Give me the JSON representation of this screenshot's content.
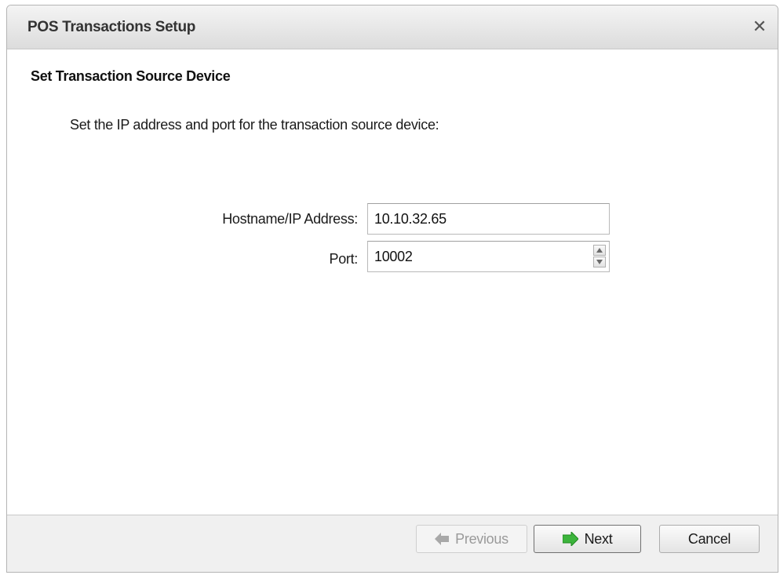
{
  "window": {
    "title": "POS Transactions Setup",
    "close_icon": "close-icon"
  },
  "content": {
    "heading": "Set Transaction Source Device",
    "instruction": "Set the IP address and port for the transaction source device:"
  },
  "form": {
    "hostname_label": "Hostname/IP Address:",
    "hostname_value": "10.10.32.65",
    "port_label": "Port:",
    "port_value": "10002"
  },
  "buttons": {
    "previous_label": "Previous",
    "next_label": "Next",
    "cancel_label": "Cancel"
  },
  "icons": {
    "previous": "arrow-left-icon",
    "next": "arrow-right-icon",
    "spin_up": "chevron-up-icon",
    "spin_down": "chevron-down-icon"
  },
  "colors": {
    "next_arrow": "#3cb43c",
    "previous_arrow_disabled": "#a8a8a8"
  }
}
